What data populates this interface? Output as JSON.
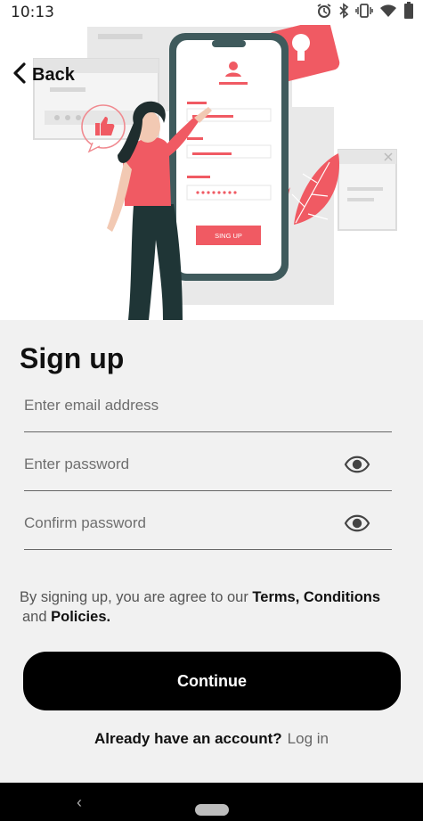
{
  "status_bar": {
    "time": "10:13",
    "icons": [
      "alarm-icon",
      "bluetooth-icon",
      "vibrate-icon",
      "wifi-icon",
      "battery-icon"
    ]
  },
  "header": {
    "back_label": "Back",
    "illustration": {
      "button_label": "SING UP",
      "colors": {
        "accent": "#f05a63",
        "phone_frame": "#3f5a5c",
        "panel": "#e6e6e6"
      }
    }
  },
  "form": {
    "title": "Sign up",
    "email_placeholder": "Enter email address",
    "password_placeholder": "Enter password",
    "confirm_placeholder": "Confirm password",
    "terms_prefix": "By signing up, you are agree to our ",
    "terms_link": "Terms, Conditions",
    "terms_and": "and ",
    "policies_link": "Policies.",
    "continue_label": "Continue",
    "already_label": "Already have an account?",
    "login_label": "Log in"
  },
  "nav_bar": {
    "back_glyph": "‹"
  },
  "colors": {
    "background": "#f1f1f1",
    "button": "#000000",
    "button_text": "#ffffff"
  }
}
